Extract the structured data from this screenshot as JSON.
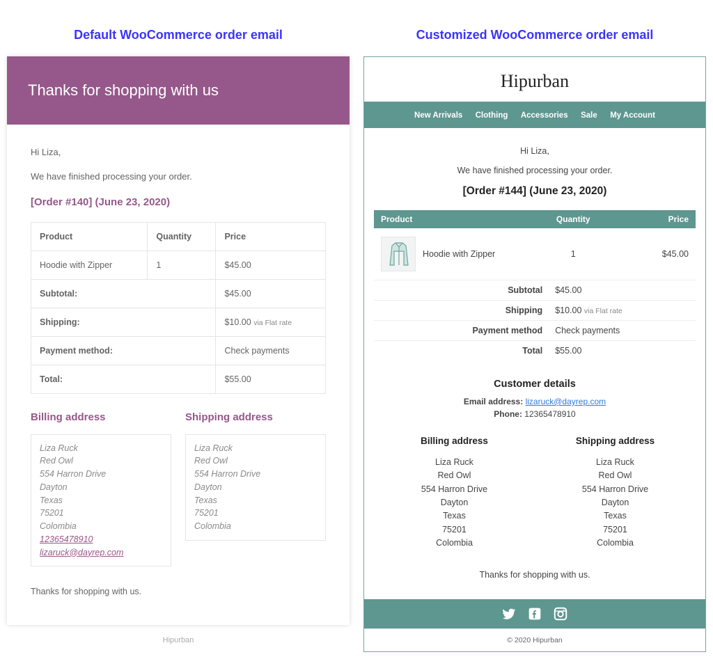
{
  "default": {
    "caption": "Default  WooCommerce order email",
    "header": "Thanks for shopping with us",
    "greeting": "Hi Liza,",
    "intro": "We have finished processing your order.",
    "order_heading": "[Order #140] (June 23, 2020)",
    "columns": {
      "product": "Product",
      "quantity": "Quantity",
      "price": "Price"
    },
    "item": {
      "name": "Hoodie with Zipper",
      "qty": "1",
      "price": "$45.00"
    },
    "summary": {
      "subtotal_label": "Subtotal:",
      "subtotal_value": "$45.00",
      "shipping_label": "Shipping:",
      "shipping_value": "$10.00 ",
      "shipping_via": "via Flat rate",
      "payment_label": "Payment method:",
      "payment_value": "Check payments",
      "total_label": "Total:",
      "total_value": "$55.00"
    },
    "billing_h": "Billing address",
    "shipping_h": "Shipping address",
    "billing": {
      "name": "Liza Ruck",
      "company": "Red Owl",
      "street": "554 Harron Drive",
      "city": "Dayton",
      "state": "Texas",
      "zip": "75201",
      "country": "Colombia",
      "phone": "12365478910",
      "email": "lizaruck@dayrep.com"
    },
    "shipping": {
      "name": "Liza Ruck",
      "company": "Red Owl",
      "street": "554 Harron Drive",
      "city": "Dayton",
      "state": "Texas",
      "zip": "75201",
      "country": "Colombia"
    },
    "closing": "Thanks for shopping with us.",
    "footer": "Hipurban"
  },
  "custom": {
    "caption": "Customized WooCommerce order email",
    "brand": "Hipurban",
    "nav": [
      "New Arrivals",
      "Clothing",
      "Accessories",
      "Sale",
      "My Account"
    ],
    "greeting": "Hi Liza,",
    "intro": "We have finished processing your order.",
    "order_heading": "[Order #144] (June 23, 2020)",
    "columns": {
      "product": "Product",
      "quantity": "Quantity",
      "price": "Price"
    },
    "item": {
      "name": "Hoodie with Zipper",
      "qty": "1",
      "price": "$45.00"
    },
    "summary": {
      "subtotal_label": "Subtotal",
      "subtotal_value": "$45.00",
      "shipping_label": "Shipping",
      "shipping_value": "$10.00 ",
      "shipping_via": "via Flat rate",
      "payment_label": "Payment method",
      "payment_value": "Check payments",
      "total_label": "Total",
      "total_value": "$55.00"
    },
    "customer_h": "Customer details",
    "email_label": "Email address:",
    "email_value": "lizaruck@dayrep.com",
    "phone_label": "Phone:",
    "phone_value": "12365478910",
    "billing_h": "Billing address",
    "shipping_h": "Shipping address",
    "billing": {
      "name": "Liza Ruck",
      "company": "Red Owl",
      "street": "554 Harron Drive",
      "city": "Dayton",
      "state": "Texas",
      "zip": "75201",
      "country": "Colombia"
    },
    "shipping": {
      "name": "Liza Ruck",
      "company": "Red Owl",
      "street": "554 Harron Drive",
      "city": "Dayton",
      "state": "Texas",
      "zip": "75201",
      "country": "Colombia"
    },
    "thanks": "Thanks for shopping with us.",
    "footer": "© 2020 Hipurban"
  }
}
